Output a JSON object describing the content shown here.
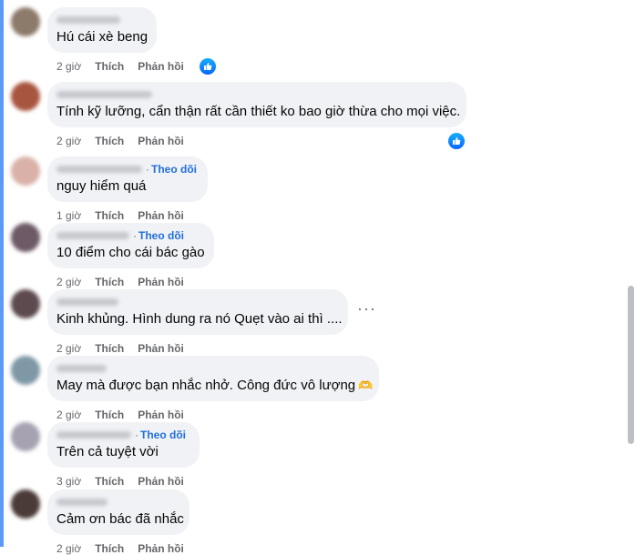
{
  "comments": [
    {
      "text": "Hú cái xè beng",
      "time": "2 giờ",
      "like_label": "Thích",
      "reply_label": "Phản hồi",
      "avatar_color": "#8c7a6a",
      "has_follow": false,
      "has_like_badge": true
    },
    {
      "text": "Tính kỹ lưỡng, cẩn thận rất cần thiết ko bao giờ thừa cho mọi việc.",
      "time": "2 giờ",
      "like_label": "Thích",
      "reply_label": "Phản hồi",
      "avatar_color": "#a8553f",
      "has_follow": false,
      "has_like_badge": true
    },
    {
      "text": "nguy hiểm quá",
      "time": "1 giờ",
      "like_label": "Thích",
      "reply_label": "Phản hồi",
      "follow_label": "Theo dõi",
      "avatar_color": "#d9b1a8",
      "has_follow": true
    },
    {
      "text": "10 điểm cho cái bác gào",
      "time": "2 giờ",
      "like_label": "Thích",
      "reply_label": "Phản hồi",
      "follow_label": "Theo dõi",
      "avatar_color": "#6d5a66",
      "has_follow": true
    },
    {
      "text": "Kinh khủng. Hình dung ra nó Quẹt vào ai thì ....",
      "time": "2 giờ",
      "like_label": "Thích",
      "reply_label": "Phản hồi",
      "avatar_color": "#5d4a4e",
      "has_follow": false,
      "has_more_menu": true,
      "more_label": "···"
    },
    {
      "text": "May mà được bạn nhắc nhở. Công đức vô lượng",
      "emoji": "🫶",
      "time": "2 giờ",
      "like_label": "Thích",
      "reply_label": "Phản hồi",
      "avatar_color": "#7e98a6",
      "has_follow": false
    },
    {
      "text": "Trên cả tuyệt vời",
      "time": "3 giờ",
      "like_label": "Thích",
      "reply_label": "Phản hồi",
      "follow_label": "Theo dõi",
      "avatar_color": "#a6a2b2",
      "has_follow": true
    },
    {
      "text": "Cảm ơn bác đã nhắc",
      "time": "2 giờ",
      "like_label": "Thích",
      "reply_label": "Phản hồi",
      "avatar_color": "#4b3b38",
      "has_follow": false
    }
  ],
  "colors": {
    "bubble": "#f0f2f5",
    "follow": "#216fdb",
    "meta": "#65676b",
    "like_badge": "#0866ff"
  }
}
